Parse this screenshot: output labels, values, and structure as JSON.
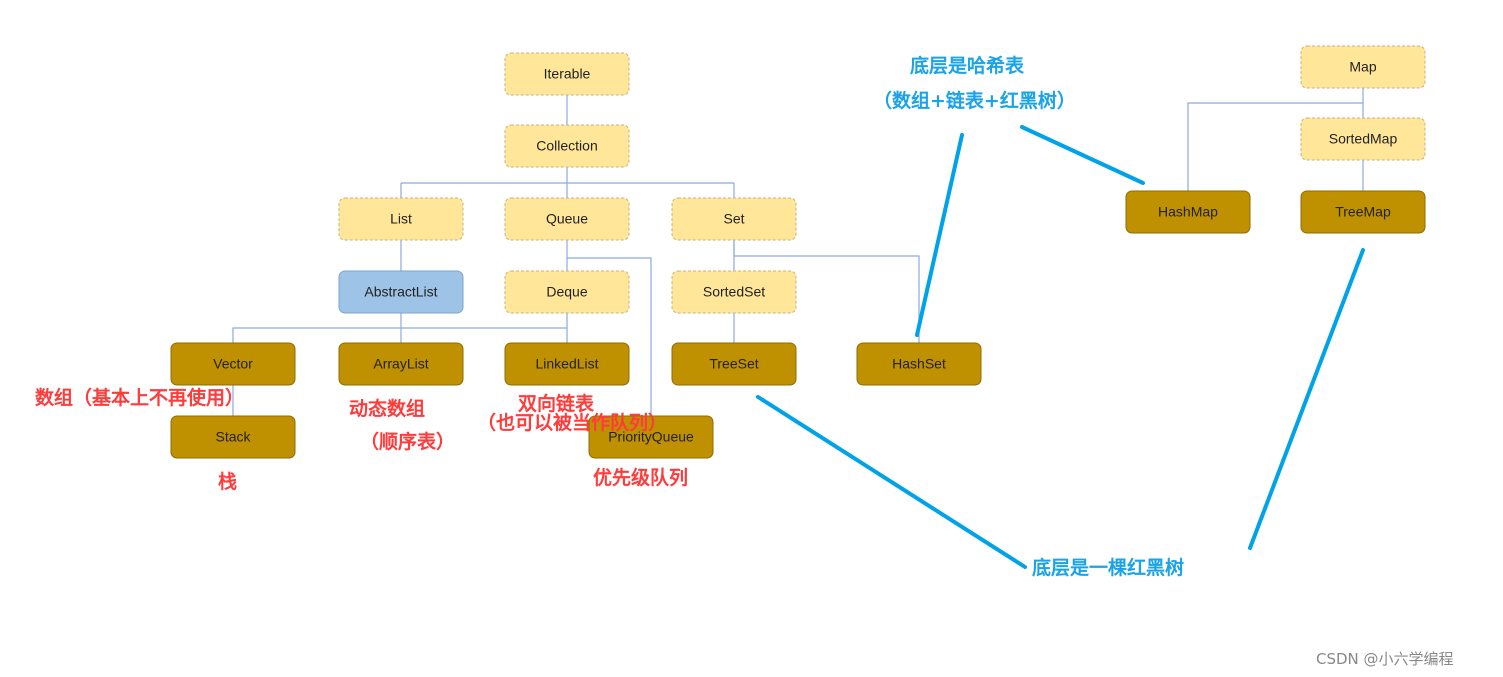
{
  "nodes": {
    "iterable": "Iterable",
    "collection": "Collection",
    "list": "List",
    "queue": "Queue",
    "set": "Set",
    "abstractlist": "AbstractList",
    "deque": "Deque",
    "sortedset": "SortedSet",
    "vector": "Vector",
    "arraylist": "ArrayList",
    "linkedlist": "LinkedList",
    "treeset": "TreeSet",
    "hashset": "HashSet",
    "stack": "Stack",
    "priorityqueue": "PriorityQueue",
    "map": "Map",
    "sortedmap": "SortedMap",
    "hashmap": "HashMap",
    "treemap": "TreeMap"
  },
  "annotations": {
    "vector_note": "数组（基本上不再使用）",
    "stack_note": "栈",
    "arraylist_note_1": "动态数组",
    "arraylist_note_2": "（顺序表）",
    "linkedlist_note_1": "双向链表",
    "linkedlist_note_2": "（也可以被当作队列）",
    "priorityqueue_note": "优先级队列",
    "hash_note_1": "底层是哈希表",
    "hash_note_2": "（数组+链表+红黑树）",
    "tree_note": "底层是一棵红黑树"
  },
  "colors": {
    "interface": "#ffe699",
    "class": "#bf9000",
    "abstract": "#9dc3e6",
    "red_annotation": "#ff3b3b",
    "blue_annotation": "#1aa3e8"
  },
  "watermark": "CSDN @小六学编程"
}
